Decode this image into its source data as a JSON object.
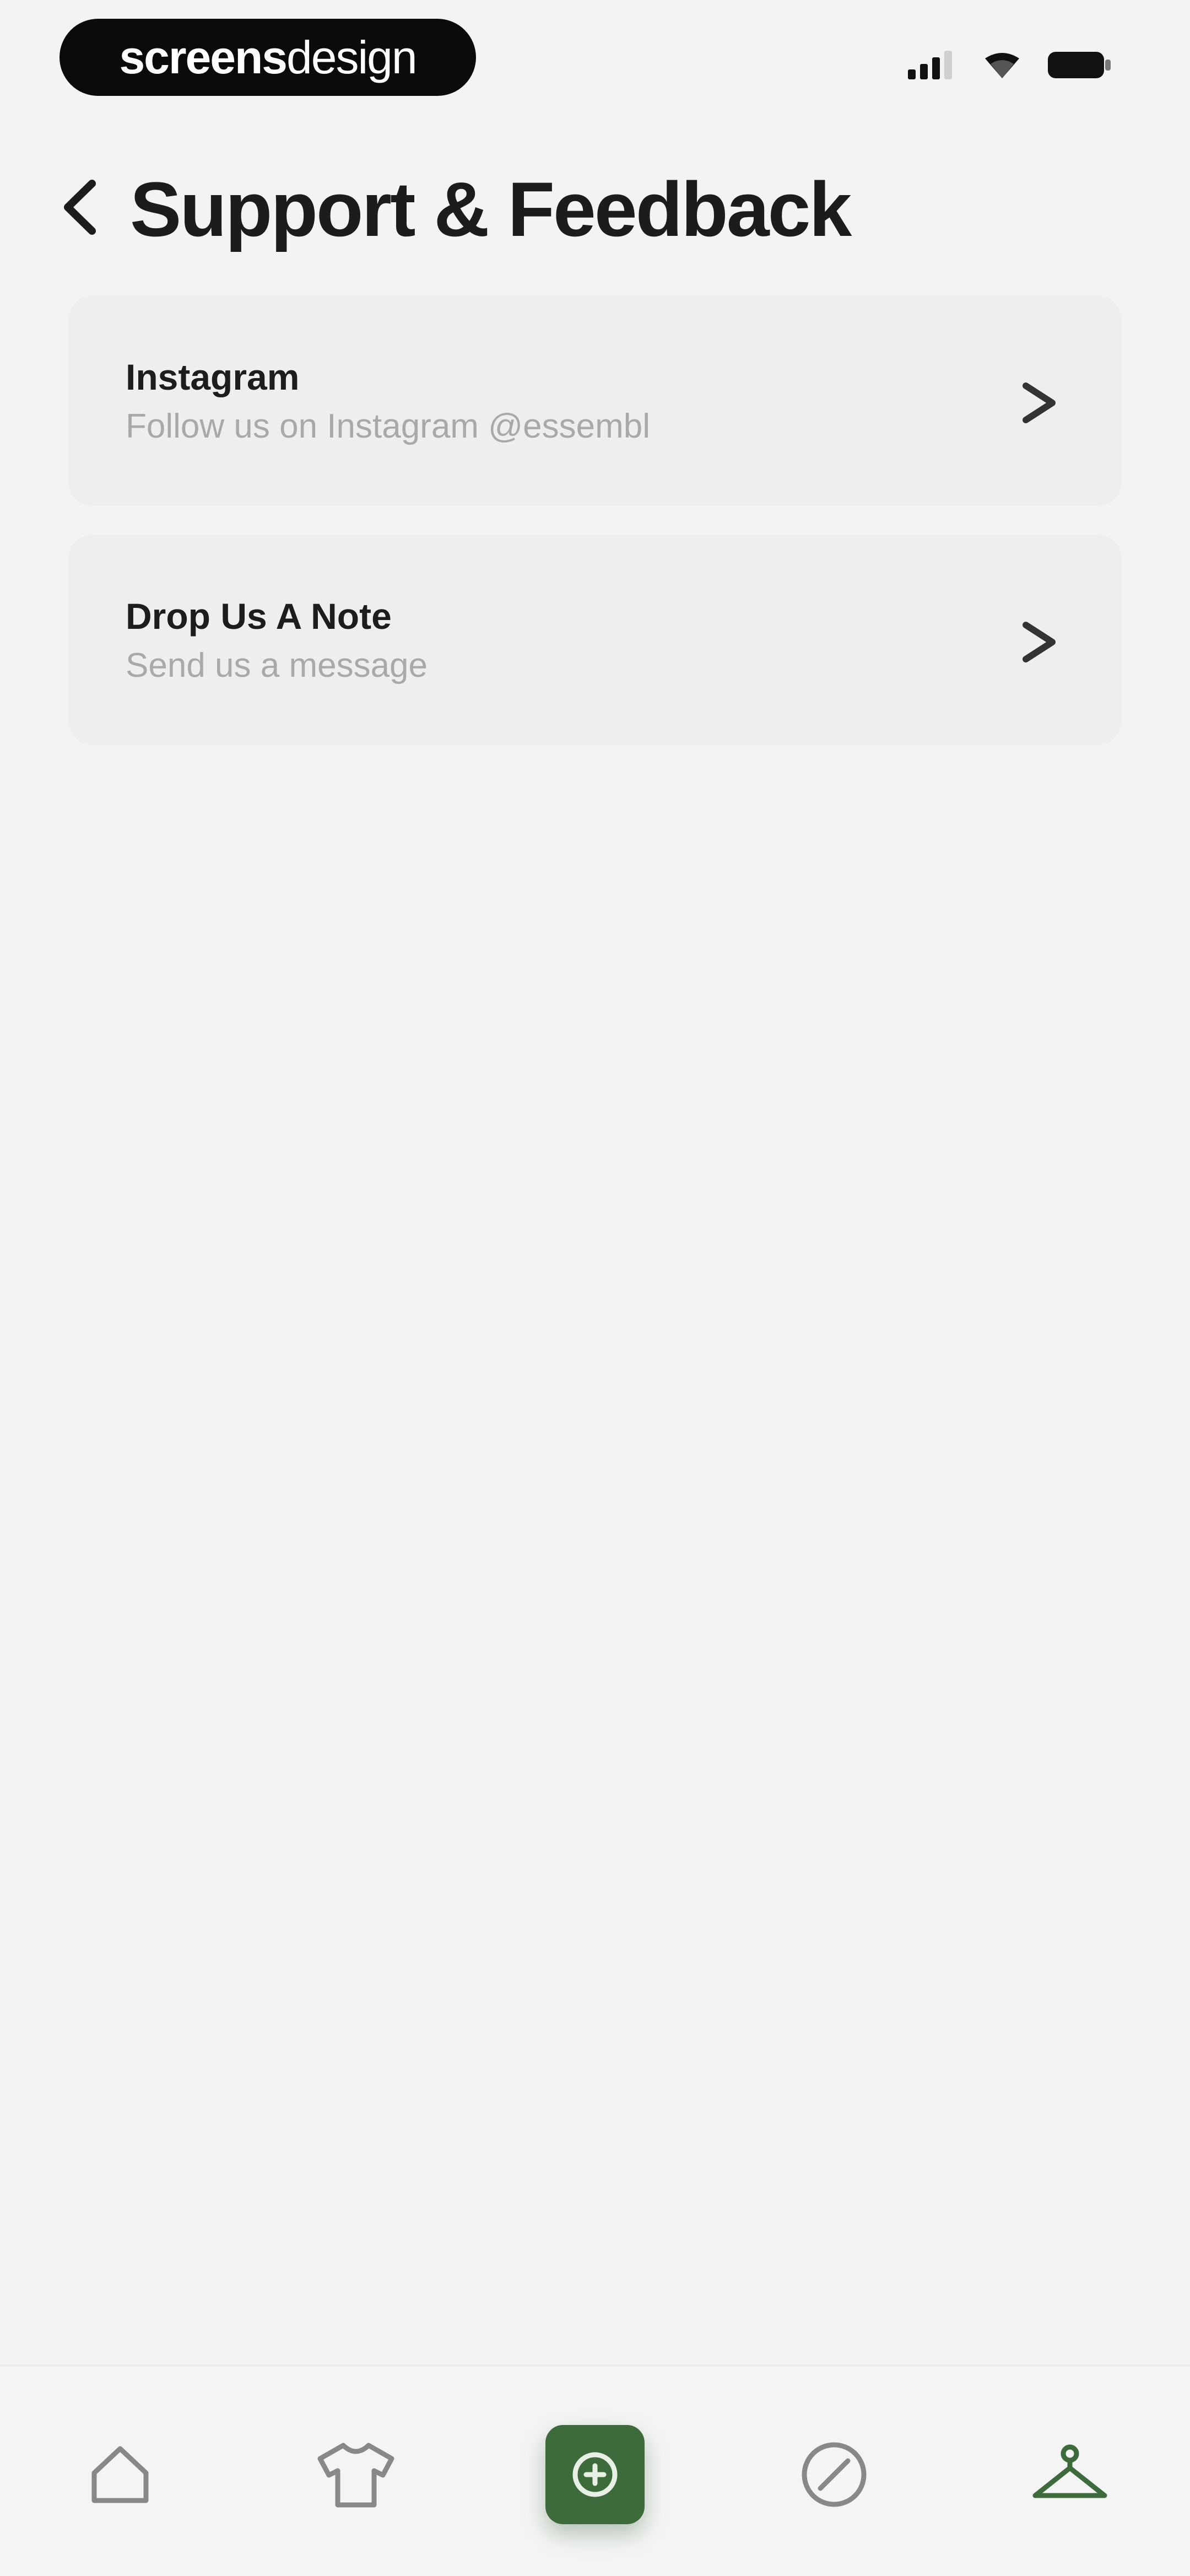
{
  "status_bar": {
    "brand_part1": "screens",
    "brand_part2": "design"
  },
  "header": {
    "title": "Support & Feedback"
  },
  "cards": [
    {
      "title": "Instagram",
      "subtitle": "Follow us on Instagram @essembl"
    },
    {
      "title": "Drop Us A Note",
      "subtitle": "Send us a message"
    }
  ],
  "bottom_nav": {
    "items": [
      "home-icon",
      "shirt-icon",
      "add-center-icon",
      "compass-icon",
      "hanger-icon"
    ],
    "accent_color": "#3d6b3c",
    "active_item": "hanger-icon"
  }
}
